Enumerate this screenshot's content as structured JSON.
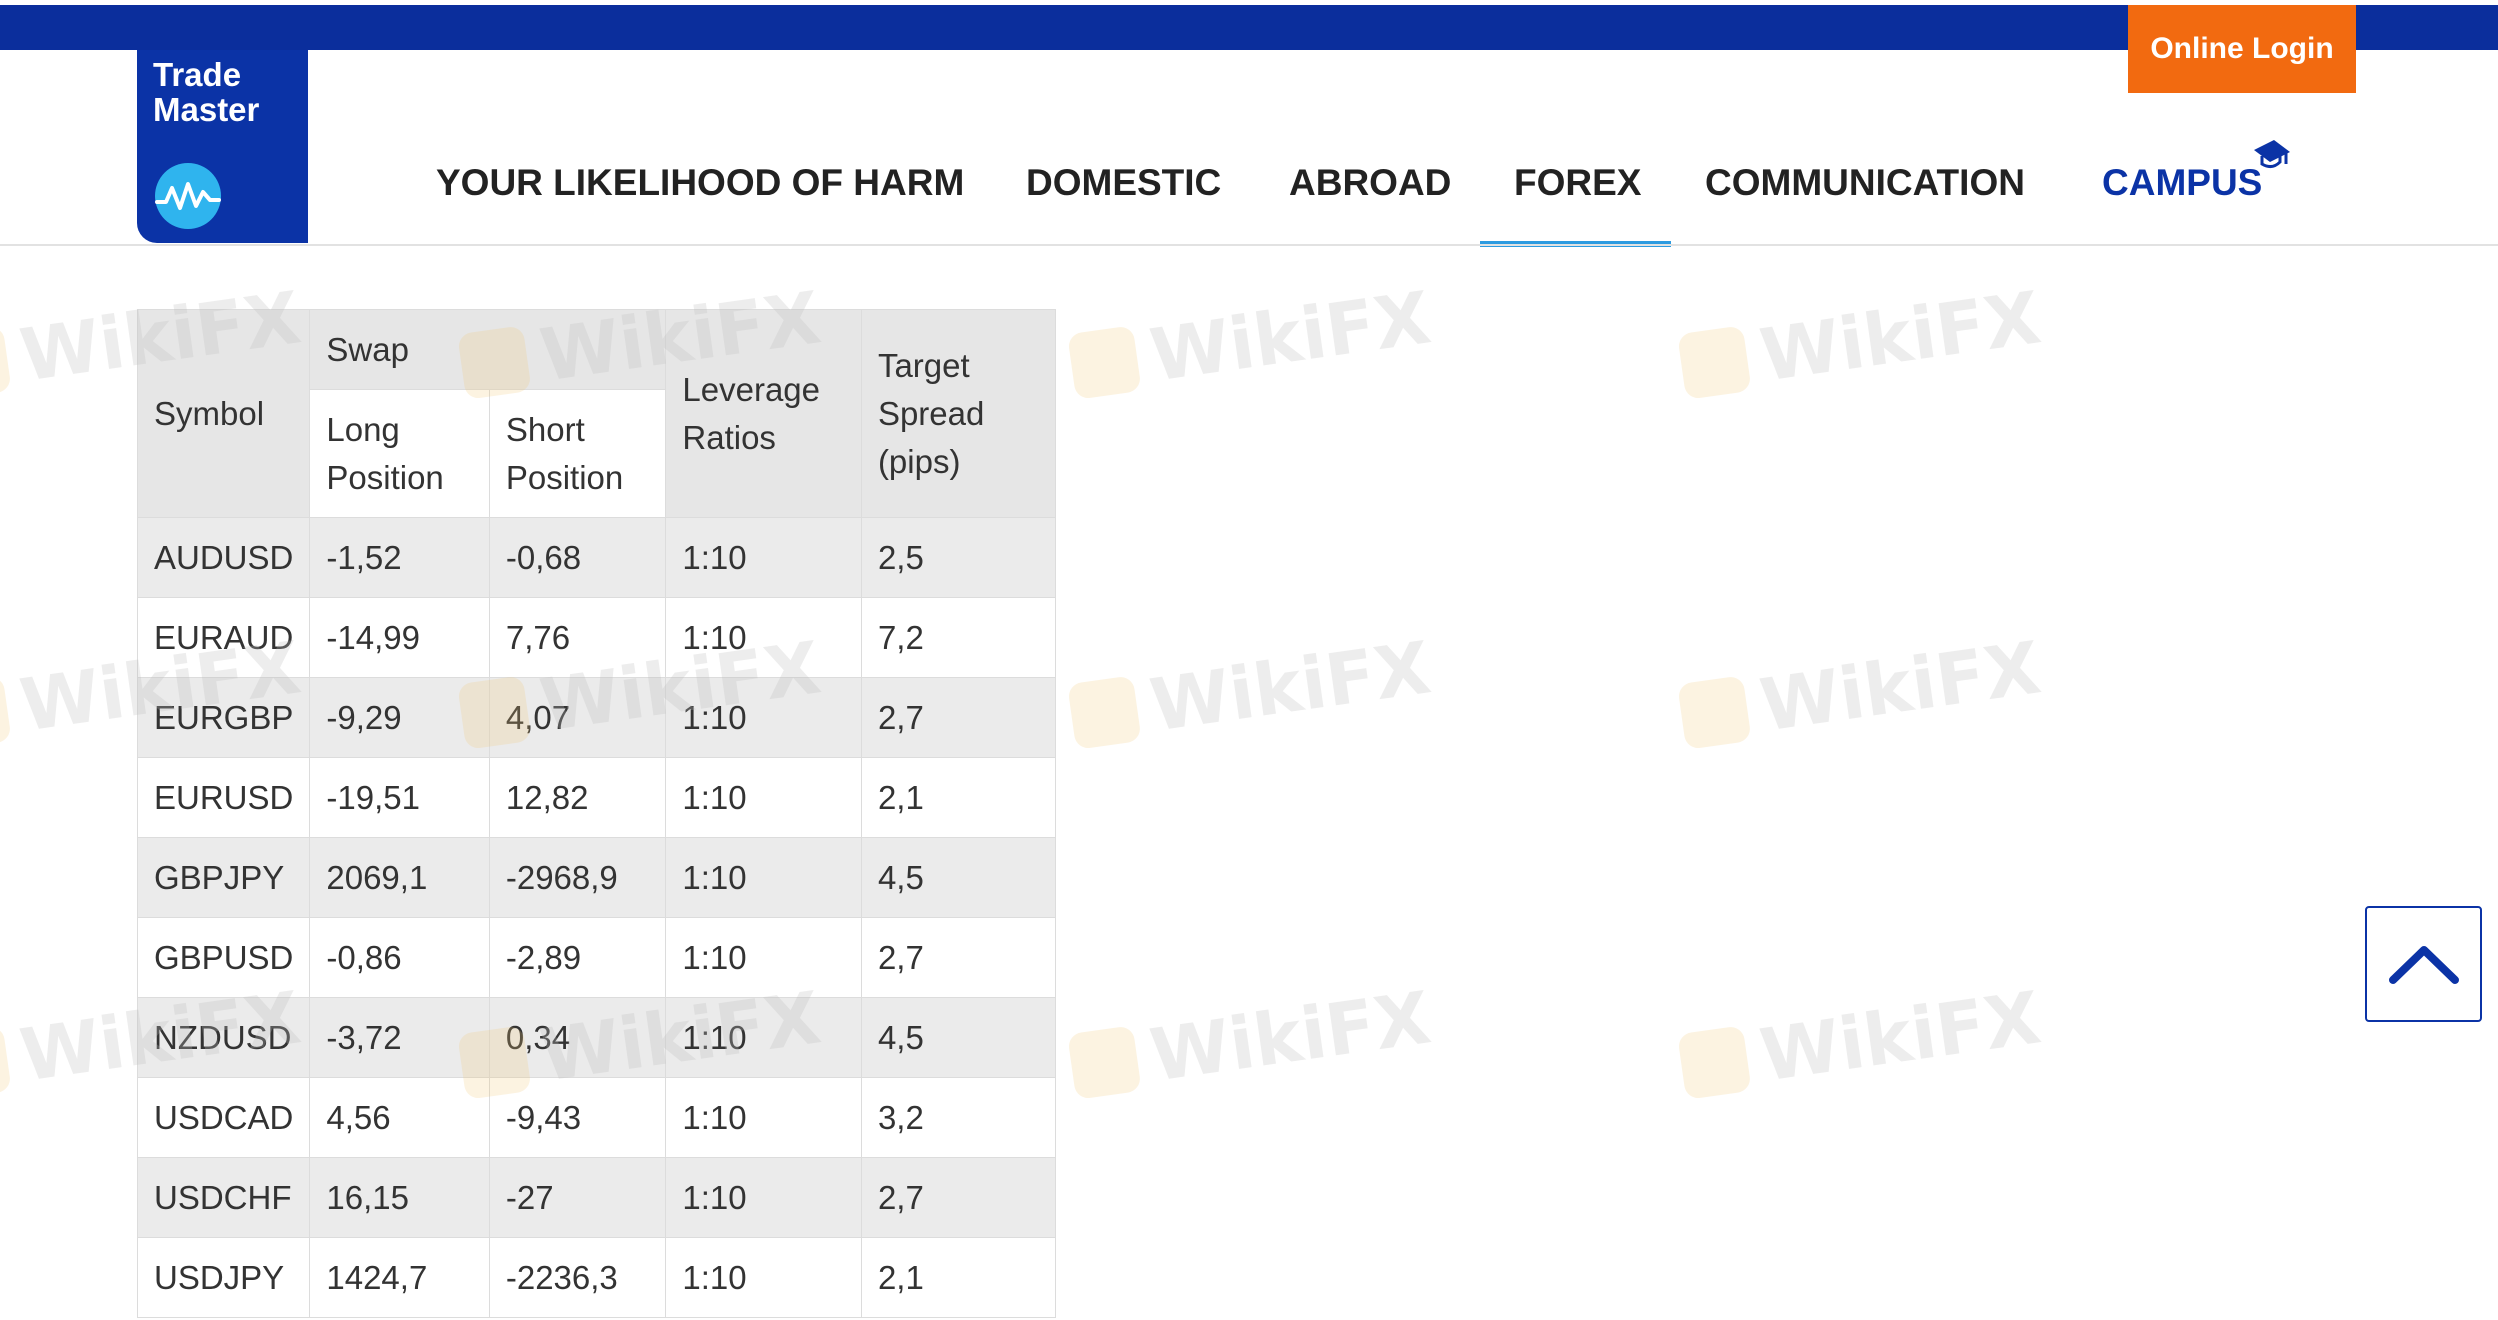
{
  "brand": {
    "logo_text": "Trade\nMaster"
  },
  "header": {
    "login_label": "Online Login"
  },
  "nav": {
    "items": [
      {
        "label": "YOUR LIKELIHOOD OF HARM"
      },
      {
        "label": "DOMESTIC"
      },
      {
        "label": "ABROAD"
      },
      {
        "label": "FOREX"
      },
      {
        "label": "COMMUNICATION"
      },
      {
        "label": "CAMPUS"
      }
    ],
    "active": "FOREX"
  },
  "watermark": {
    "text": "WikiFX"
  },
  "table": {
    "headers": {
      "symbol": "Symbol",
      "swap": "Swap",
      "long": "Long\nPosition",
      "short": "Short\nPosition",
      "leverage": "Leverage\nRatios",
      "spread": "Target\nSpread\n(pips)"
    },
    "rows": [
      {
        "symbol": "AUDUSD",
        "long": "-1,52",
        "short": "-0,68",
        "leverage": "1:10",
        "spread": "2,5"
      },
      {
        "symbol": "EURAUD",
        "long": "-14,99",
        "short": "7,76",
        "leverage": "1:10",
        "spread": "7,2"
      },
      {
        "symbol": "EURGBP",
        "long": "-9,29",
        "short": "4,07",
        "leverage": "1:10",
        "spread": "2,7"
      },
      {
        "symbol": "EURUSD",
        "long": "-19,51",
        "short": "12,82",
        "leverage": "1:10",
        "spread": "2,1"
      },
      {
        "symbol": "GBPJPY",
        "long": "2069,1",
        "short": "-2968,9",
        "leverage": "1:10",
        "spread": "4,5"
      },
      {
        "symbol": "GBPUSD",
        "long": "-0,86",
        "short": "-2,89",
        "leverage": "1:10",
        "spread": "2,7"
      },
      {
        "symbol": "NZDUSD",
        "long": "-3,72",
        "short": "0,34",
        "leverage": "1:10",
        "spread": "4,5"
      },
      {
        "symbol": "USDCAD",
        "long": "4,56",
        "short": "-9,43",
        "leverage": "1:10",
        "spread": "3,2"
      },
      {
        "symbol": "USDCHF",
        "long": "16,15",
        "short": "-27",
        "leverage": "1:10",
        "spread": "2,7"
      },
      {
        "symbol": "USDJPY",
        "long": "1424,7",
        "short": "-2236,3",
        "leverage": "1:10",
        "spread": "2,1"
      }
    ]
  },
  "colors": {
    "brand_blue": "#0b33a6",
    "login_orange": "#f26a10",
    "active_underline": "#2d9be0"
  },
  "icons": {
    "logo_icon": "pulse-wave-icon",
    "campus_icon": "graduation-cap-icon",
    "scroll_icon": "chevron-up-icon"
  }
}
